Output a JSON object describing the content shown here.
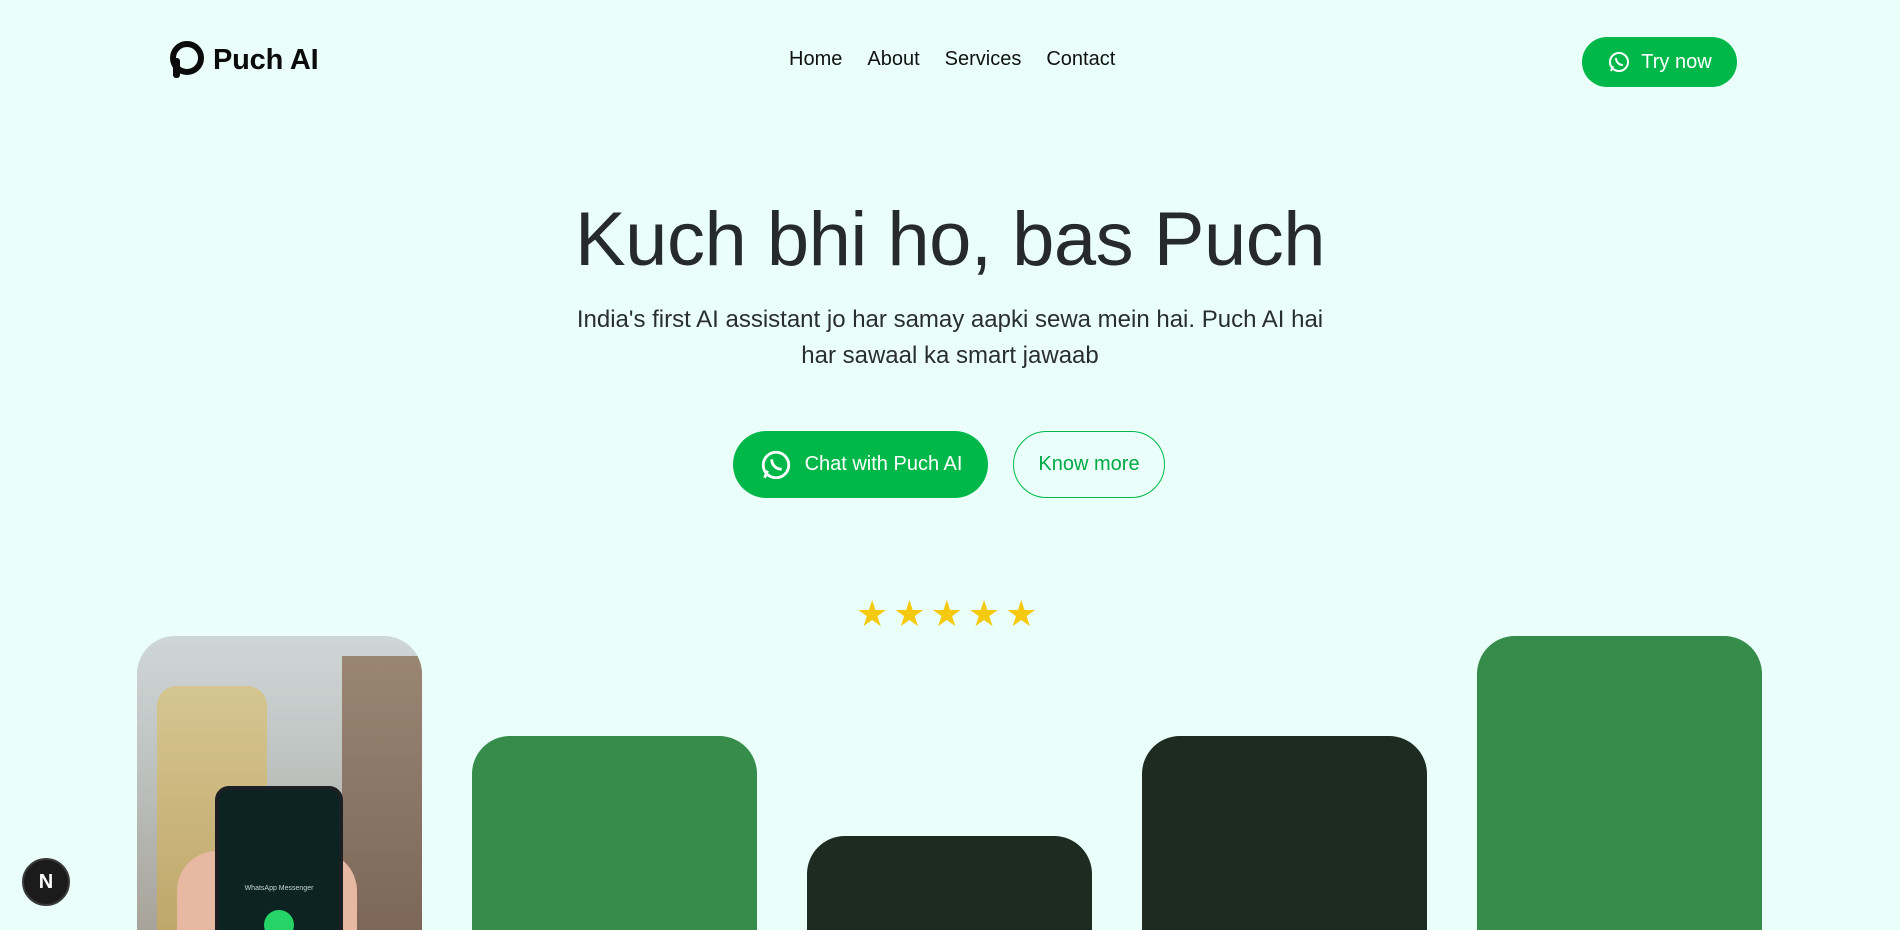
{
  "brand": {
    "name": "Puch AI",
    "logo_icon": "puch-logo-icon"
  },
  "nav": {
    "items": [
      "Home",
      "About",
      "Services",
      "Contact"
    ]
  },
  "header": {
    "try_label": "Try now",
    "try_icon": "whatsapp-icon"
  },
  "hero": {
    "title": "Kuch bhi ho, bas Puch",
    "subtitle": "India's first AI assistant jo har samay aapki sewa mein hai. Puch AI hai har sawaal ka smart jawaab",
    "chat_label": "Chat with Puch AI",
    "know_label": "Know more"
  },
  "rating": {
    "stars": 5
  },
  "phone_screen": {
    "text": "WhatsApp Messenger"
  },
  "badge": {
    "letter": "N"
  },
  "colors": {
    "background": "#eafff9",
    "accent": "#00b84a",
    "card_green": "#368c4a",
    "card_dark": "#1e2b21",
    "star": "#f4c910"
  }
}
